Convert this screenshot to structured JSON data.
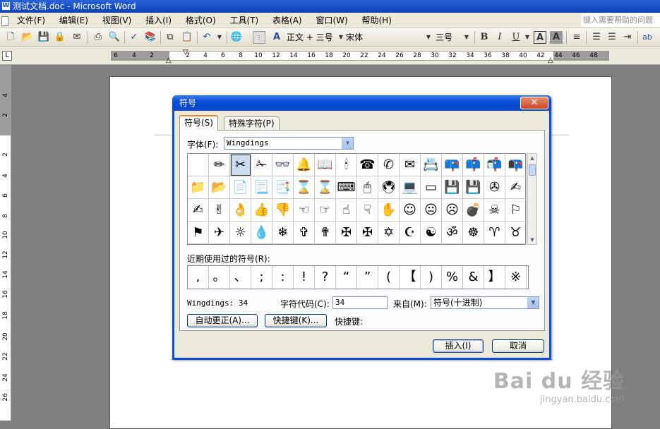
{
  "window": {
    "title": "测试文档.doc - Microsoft Word",
    "app_icon": "W"
  },
  "menu": {
    "items": [
      "文件(F)",
      "编辑(E)",
      "视图(V)",
      "插入(I)",
      "格式(O)",
      "工具(T)",
      "表格(A)",
      "窗口(W)",
      "帮助(H)"
    ],
    "help_box": "键入需要帮助的问题"
  },
  "toolbar": {
    "style": "正文 + 三号",
    "font": "宋体",
    "size": "三号",
    "bold": "B",
    "italic": "I",
    "underline": "U",
    "icons": [
      "new-icon",
      "open-icon",
      "save-icon",
      "permission-icon",
      "email-icon",
      "print-icon",
      "print-preview-icon",
      "spelling-icon",
      "research-icon",
      "copy-icon",
      "paste-icon",
      "undo-icon",
      "hyperlink-icon",
      "more-icon",
      "styles-icon"
    ]
  },
  "ruler": {
    "corner": "L",
    "numbers": [
      "6",
      "4",
      "2",
      "2",
      "4",
      "6",
      "8",
      "10",
      "12",
      "14",
      "16",
      "18",
      "20",
      "22",
      "24",
      "26",
      "28",
      "30",
      "32",
      "34",
      "36",
      "38",
      "40",
      "42",
      "44",
      "46",
      "48"
    ],
    "vnumbers": [
      "4",
      "2",
      "2",
      "4",
      "6",
      "8",
      "10",
      "12",
      "14",
      "16",
      "18",
      "20",
      "22",
      "24",
      "26"
    ]
  },
  "dialog": {
    "title": "符号",
    "close": "✕",
    "tabs": [
      "符号(S)",
      "特殊字符(P)"
    ],
    "font_label": "字体(F):",
    "font_value": "Wingdings",
    "symbols": [
      [
        "",
        "✏",
        "✂",
        "✁",
        "👓",
        "🔔",
        "📖",
        "🕯",
        "☎",
        "✆",
        "✉",
        "📇",
        "📪",
        "📫",
        "📬",
        "📭"
      ],
      [
        "📁",
        "📂",
        "📄",
        "📃",
        "📑",
        "⌛",
        "⌛",
        "⌨",
        "🖱",
        "🖲",
        "💻",
        "▭",
        "💾",
        "💾",
        "✇",
        "✍"
      ],
      [
        "✍",
        "✌",
        "👌",
        "👍",
        "👎",
        "☜",
        "☞",
        "☝",
        "☟",
        "✋",
        "☺",
        "😐",
        "☹",
        "💣",
        "☠",
        "⚐"
      ],
      [
        "⚑",
        "✈",
        "☼",
        "💧",
        "❄",
        "✞",
        "✟",
        "✠",
        "✠",
        "✡",
        "☪",
        "☯",
        "ॐ",
        "☸",
        "♈",
        "♉"
      ]
    ],
    "recent_label": "近期使用过的符号(R):",
    "recent": [
      ",",
      "。",
      "、",
      ";",
      ":",
      "!",
      "?",
      "“",
      "”",
      "(",
      "【",
      ")",
      "%",
      "&",
      "】",
      "※"
    ],
    "char_info": "Wingdings: 34",
    "code_label": "字符代码(C):",
    "code_value": "34",
    "from_label": "来自(M):",
    "from_value": "符号(十进制)",
    "autocorrect_btn": "自动更正(A)...",
    "shortcut_btn": "快捷键(K)...",
    "shortcut_label": "快捷键:",
    "insert_btn": "插入(I)",
    "cancel_btn": "取消"
  },
  "watermark": {
    "logo": "Bai du 经验",
    "site": "jingyan.baidu.com"
  }
}
